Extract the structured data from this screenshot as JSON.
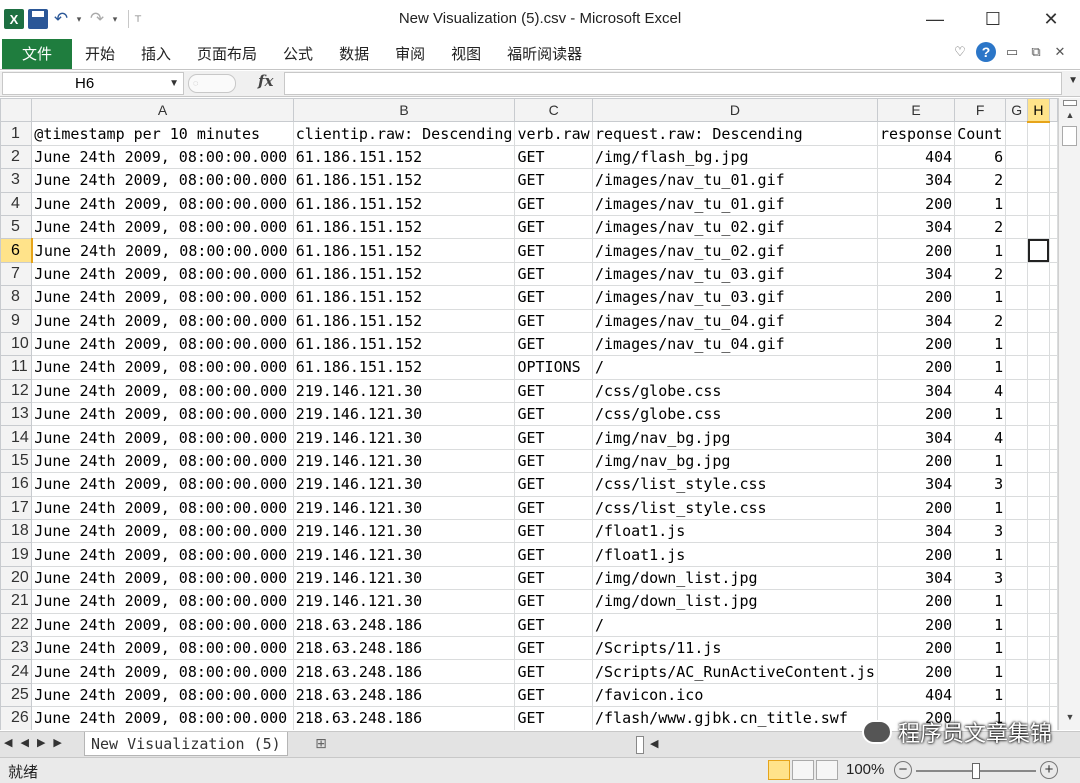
{
  "window": {
    "title": "New Visualization (5).csv - Microsoft Excel",
    "minimize": "—",
    "maximize": "☐",
    "close": "✕"
  },
  "qat": {
    "excel_logo": "X",
    "undo": "↶",
    "redo": "↷",
    "dropdown": "▾",
    "customize": "⊤"
  },
  "ribbon": {
    "file_tab": "文件",
    "tabs": [
      "开始",
      "插入",
      "页面布局",
      "公式",
      "数据",
      "审阅",
      "视图",
      "福昕阅读器"
    ],
    "help": "?"
  },
  "formula_bar": {
    "name_box": "H6",
    "fx": "fx",
    "formula": ""
  },
  "grid": {
    "columns": [
      "A",
      "B",
      "C",
      "D",
      "E",
      "F",
      "G",
      "H"
    ],
    "selected_column": "H",
    "selected_row": "6",
    "rows": [
      [
        "1",
        "@timestamp per 10 minutes",
        "clientip.raw: Descending",
        "verb.raw",
        "request.raw: Descending",
        "response",
        "Count",
        "",
        ""
      ],
      [
        "2",
        "June 24th 2009, 08:00:00.000",
        "61.186.151.152",
        "GET",
        "/img/flash_bg.jpg",
        "404",
        "6",
        "",
        ""
      ],
      [
        "3",
        "June 24th 2009, 08:00:00.000",
        "61.186.151.152",
        "GET",
        "/images/nav_tu_01.gif",
        "304",
        "2",
        "",
        ""
      ],
      [
        "4",
        "June 24th 2009, 08:00:00.000",
        "61.186.151.152",
        "GET",
        "/images/nav_tu_01.gif",
        "200",
        "1",
        "",
        ""
      ],
      [
        "5",
        "June 24th 2009, 08:00:00.000",
        "61.186.151.152",
        "GET",
        "/images/nav_tu_02.gif",
        "304",
        "2",
        "",
        ""
      ],
      [
        "6",
        "June 24th 2009, 08:00:00.000",
        "61.186.151.152",
        "GET",
        "/images/nav_tu_02.gif",
        "200",
        "1",
        "",
        ""
      ],
      [
        "7",
        "June 24th 2009, 08:00:00.000",
        "61.186.151.152",
        "GET",
        "/images/nav_tu_03.gif",
        "304",
        "2",
        "",
        ""
      ],
      [
        "8",
        "June 24th 2009, 08:00:00.000",
        "61.186.151.152",
        "GET",
        "/images/nav_tu_03.gif",
        "200",
        "1",
        "",
        ""
      ],
      [
        "9",
        "June 24th 2009, 08:00:00.000",
        "61.186.151.152",
        "GET",
        "/images/nav_tu_04.gif",
        "304",
        "2",
        "",
        ""
      ],
      [
        "10",
        "June 24th 2009, 08:00:00.000",
        "61.186.151.152",
        "GET",
        "/images/nav_tu_04.gif",
        "200",
        "1",
        "",
        ""
      ],
      [
        "11",
        "June 24th 2009, 08:00:00.000",
        "61.186.151.152",
        "OPTIONS",
        "/",
        "200",
        "1",
        "",
        ""
      ],
      [
        "12",
        "June 24th 2009, 08:00:00.000",
        "219.146.121.30",
        "GET",
        "/css/globe.css",
        "304",
        "4",
        "",
        ""
      ],
      [
        "13",
        "June 24th 2009, 08:00:00.000",
        "219.146.121.30",
        "GET",
        "/css/globe.css",
        "200",
        "1",
        "",
        ""
      ],
      [
        "14",
        "June 24th 2009, 08:00:00.000",
        "219.146.121.30",
        "GET",
        "/img/nav_bg.jpg",
        "304",
        "4",
        "",
        ""
      ],
      [
        "15",
        "June 24th 2009, 08:00:00.000",
        "219.146.121.30",
        "GET",
        "/img/nav_bg.jpg",
        "200",
        "1",
        "",
        ""
      ],
      [
        "16",
        "June 24th 2009, 08:00:00.000",
        "219.146.121.30",
        "GET",
        "/css/list_style.css",
        "304",
        "3",
        "",
        ""
      ],
      [
        "17",
        "June 24th 2009, 08:00:00.000",
        "219.146.121.30",
        "GET",
        "/css/list_style.css",
        "200",
        "1",
        "",
        ""
      ],
      [
        "18",
        "June 24th 2009, 08:00:00.000",
        "219.146.121.30",
        "GET",
        "/float1.js",
        "304",
        "3",
        "",
        ""
      ],
      [
        "19",
        "June 24th 2009, 08:00:00.000",
        "219.146.121.30",
        "GET",
        "/float1.js",
        "200",
        "1",
        "",
        ""
      ],
      [
        "20",
        "June 24th 2009, 08:00:00.000",
        "219.146.121.30",
        "GET",
        "/img/down_list.jpg",
        "304",
        "3",
        "",
        ""
      ],
      [
        "21",
        "June 24th 2009, 08:00:00.000",
        "219.146.121.30",
        "GET",
        "/img/down_list.jpg",
        "200",
        "1",
        "",
        ""
      ],
      [
        "22",
        "June 24th 2009, 08:00:00.000",
        "218.63.248.186",
        "GET",
        "/",
        "200",
        "1",
        "",
        ""
      ],
      [
        "23",
        "June 24th 2009, 08:00:00.000",
        "218.63.248.186",
        "GET",
        "/Scripts/11.js",
        "200",
        "1",
        "",
        ""
      ],
      [
        "24",
        "June 24th 2009, 08:00:00.000",
        "218.63.248.186",
        "GET",
        "/Scripts/AC_RunActiveContent.js",
        "200",
        "1",
        "",
        ""
      ],
      [
        "25",
        "June 24th 2009, 08:00:00.000",
        "218.63.248.186",
        "GET",
        "/favicon.ico",
        "404",
        "1",
        "",
        ""
      ],
      [
        "26",
        "June 24th 2009, 08:00:00.000",
        "218.63.248.186",
        "GET",
        "/flash/www.gjbk.cn_title.swf",
        "200",
        "1",
        "",
        ""
      ]
    ]
  },
  "sheets": {
    "nav": [
      "◀",
      "◀",
      "▶",
      "▶"
    ],
    "active_tab": "New Visualization (5)"
  },
  "watermark": "程序员文章集锦",
  "status": {
    "ready": "就绪",
    "zoom": "100%",
    "zoom_minus": "−",
    "zoom_plus": "+"
  }
}
